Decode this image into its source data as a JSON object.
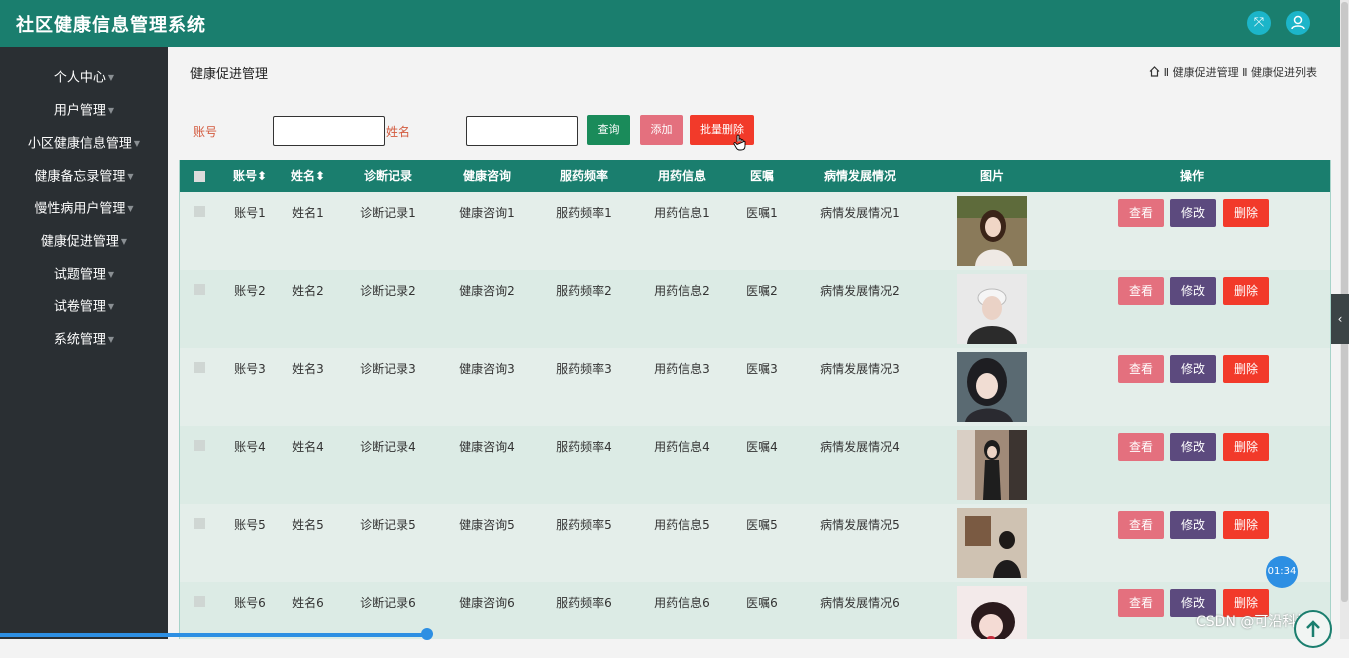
{
  "app": {
    "title": "社区健康信息管理系统"
  },
  "header_icons": [
    {
      "icon": "fullscreen-icon",
      "glyph": "⤧"
    },
    {
      "icon": "user-icon",
      "glyph": "👤"
    }
  ],
  "sidebar": {
    "items": [
      {
        "label": "个人中心"
      },
      {
        "label": "用户管理"
      },
      {
        "label": "小区健康信息管理"
      },
      {
        "label": "健康备忘录管理"
      },
      {
        "label": "慢性病用户管理"
      },
      {
        "label": "健康促进管理"
      },
      {
        "label": "试题管理"
      },
      {
        "label": "试卷管理"
      },
      {
        "label": "系统管理"
      }
    ]
  },
  "page": {
    "title": "健康促进管理",
    "breadcrumb": "Ⅱ 健康促进管理 Ⅱ 健康促进列表"
  },
  "search": {
    "account_label": "账号",
    "name_label": "姓名",
    "account_value": "",
    "name_value": "",
    "query_button": "查询",
    "add_button": "添加",
    "batch_delete_button": "批量删除"
  },
  "table": {
    "headers": {
      "account": "账号",
      "name": "姓名",
      "diagnosis": "诊断记录",
      "consult": "健康咨询",
      "frequency": "服药频率",
      "medicine": "用药信息",
      "advice": "医嘱",
      "progress": "病情发展情况",
      "photo": "图片",
      "actions": "操作"
    },
    "sort_glyph": "⬍",
    "rows": [
      {
        "account": "账号1",
        "name": "姓名1",
        "diagnosis": "诊断记录1",
        "consult": "健康咨询1",
        "frequency": "服药频率1",
        "medicine": "用药信息1",
        "advice": "医嘱1",
        "progress": "病情发展情况1"
      },
      {
        "account": "账号2",
        "name": "姓名2",
        "diagnosis": "诊断记录2",
        "consult": "健康咨询2",
        "frequency": "服药频率2",
        "medicine": "用药信息2",
        "advice": "医嘱2",
        "progress": "病情发展情况2"
      },
      {
        "account": "账号3",
        "name": "姓名3",
        "diagnosis": "诊断记录3",
        "consult": "健康咨询3",
        "frequency": "服药频率3",
        "medicine": "用药信息3",
        "advice": "医嘱3",
        "progress": "病情发展情况3"
      },
      {
        "account": "账号4",
        "name": "姓名4",
        "diagnosis": "诊断记录4",
        "consult": "健康咨询4",
        "frequency": "服药频率4",
        "medicine": "用药信息4",
        "advice": "医嘱4",
        "progress": "病情发展情况4"
      },
      {
        "account": "账号5",
        "name": "姓名5",
        "diagnosis": "诊断记录5",
        "consult": "健康咨询5",
        "frequency": "服药频率5",
        "medicine": "用药信息5",
        "advice": "医嘱5",
        "progress": "病情发展情况5"
      },
      {
        "account": "账号6",
        "name": "姓名6",
        "diagnosis": "诊断记录6",
        "consult": "健康咨询6",
        "frequency": "服药频率6",
        "medicine": "用药信息6",
        "advice": "医嘱6",
        "progress": "病情发展情况6"
      }
    ],
    "row_actions": {
      "view": "查看",
      "edit": "修改",
      "delete": "删除"
    }
  },
  "overlay": {
    "timer": "01:34",
    "watermark": "CSDN @可沿科技"
  },
  "colors": {
    "header_bg": "#1a7e6e",
    "sidebar_bg": "#2a2f33",
    "query_btn": "#1a8b5a",
    "add_btn": "#e4707e",
    "batch_delete_btn": "#f23a2a",
    "view_btn": "#e4707e",
    "edit_btn": "#5c4a7e",
    "delete_btn": "#f23a2a"
  }
}
